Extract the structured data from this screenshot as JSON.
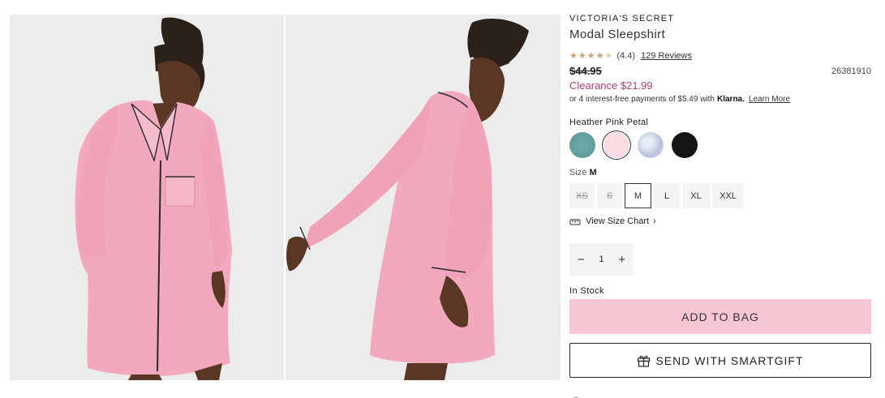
{
  "product": {
    "brand": "VICTORIA'S SECRET",
    "title": "Modal Sleepshirt",
    "rating_value": 4.4,
    "rating_text": "(4.4)",
    "reviews_link": "129 Reviews",
    "original_price": "$44.95",
    "sku": "26381910",
    "sale_price": "Clearance $21.99",
    "klarna_text": "or 4 interest-free payments of $5.49 with",
    "klarna_logo": "Klarna.",
    "klarna_learn": "Learn More"
  },
  "colors": {
    "selected_label": "Heather Pink Petal",
    "swatches": [
      {
        "name": "teal",
        "hex": "#5f9c9a"
      },
      {
        "name": "heather-pink-petal",
        "hex": "#f9dde2",
        "selected": true
      },
      {
        "name": "blue-floral",
        "hex": "#cfd6e8"
      },
      {
        "name": "black",
        "hex": "#151515"
      }
    ]
  },
  "size": {
    "label": "Size",
    "selected": "M",
    "options": [
      {
        "label": "XS",
        "available": false
      },
      {
        "label": "S",
        "available": false
      },
      {
        "label": "M",
        "available": true,
        "selected": true
      },
      {
        "label": "L",
        "available": true
      },
      {
        "label": "XL",
        "available": true
      },
      {
        "label": "XXL",
        "available": true
      }
    ],
    "chart_link": "View Size Chart"
  },
  "quantity": {
    "value": "1",
    "minus": "−",
    "plus": "+"
  },
  "stock_status": "In Stock",
  "buttons": {
    "add_to_bag": "ADD TO BAG",
    "smartgift": "SEND WITH SMARTGIFT"
  },
  "theme": {
    "accent_pink": "#f6c6d3",
    "sale_color": "#b0426c",
    "star_color": "#c8a472"
  },
  "icons": {
    "star": "star-icon",
    "ruler": "ruler-icon",
    "chevron": "chevron-right-icon",
    "gift": "gift-icon"
  }
}
